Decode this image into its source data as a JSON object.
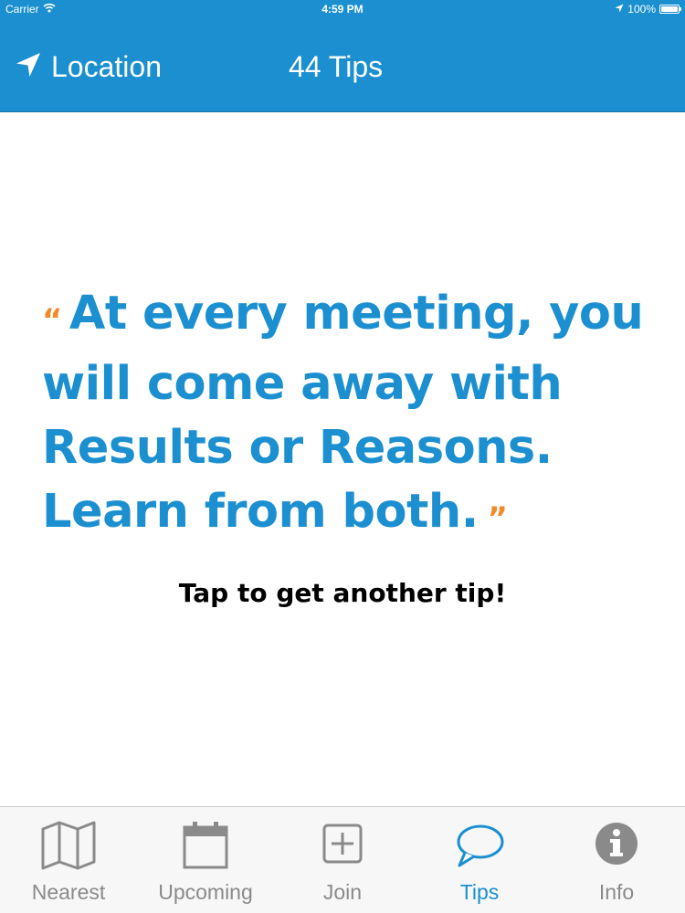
{
  "status_bar": {
    "carrier": "Carrier",
    "time": "4:59 PM",
    "battery": "100%",
    "battery_level": 1.0
  },
  "nav": {
    "location_label": "Location",
    "location_icon": "location-arrow-icon",
    "title": "44 Tips"
  },
  "tip": {
    "open_quote": "“",
    "text": "At every meeting, you will come away with Results or Reasons. Learn from both.",
    "close_quote": "”",
    "hint": "Tap to get another tip!"
  },
  "tabs": [
    {
      "label": "Nearest",
      "icon": "map-icon",
      "active": false
    },
    {
      "label": "Upcoming",
      "icon": "calendar-icon",
      "active": false
    },
    {
      "label": "Join",
      "icon": "plus-square-icon",
      "active": false
    },
    {
      "label": "Tips",
      "icon": "speech-bubble-icon",
      "active": true
    },
    {
      "label": "Info",
      "icon": "info-icon",
      "active": false
    }
  ],
  "colors": {
    "brand_blue": "#1b8fcf",
    "quote_orange": "#f08a2c",
    "tab_inactive": "#8a8a8a",
    "tab_bar_bg": "#f7f7f7"
  }
}
